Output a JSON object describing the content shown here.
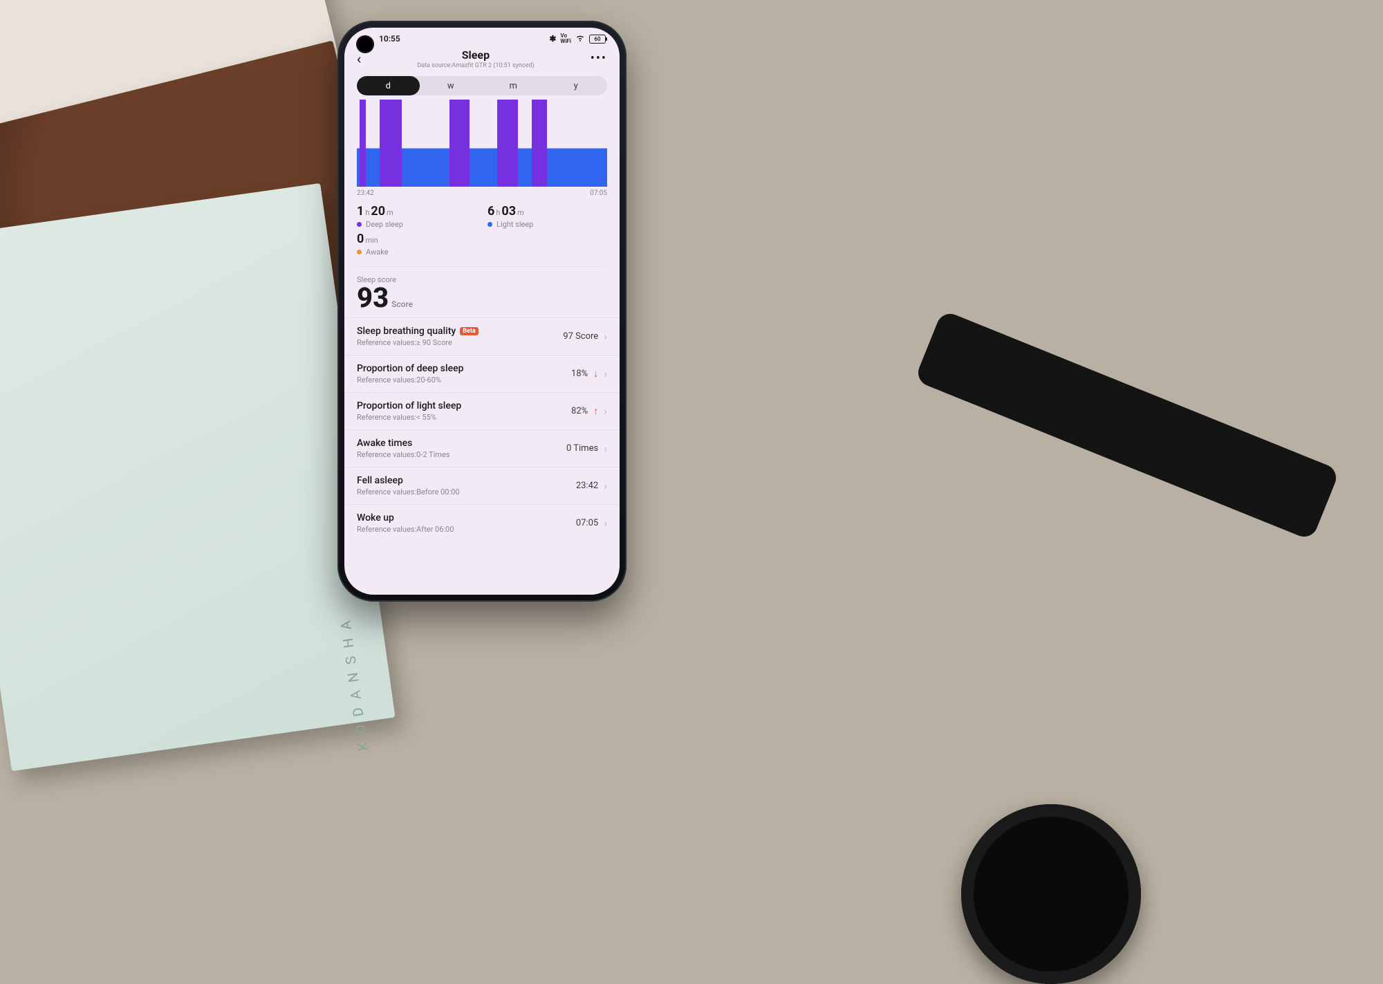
{
  "status": {
    "time": "10:55",
    "battery_text": "60"
  },
  "header": {
    "title": "Sleep",
    "subtitle": "Data source:Amazfit GTR 2 (10:51 synced)"
  },
  "range": {
    "options": [
      "d",
      "w",
      "m",
      "y"
    ],
    "active": "d"
  },
  "chart_data": {
    "type": "bar",
    "title": "Sleep stages timeline",
    "xlabel": "",
    "ylabel": "",
    "x_start": "23:42",
    "x_end": "07:05",
    "light_sleep_band_pct_top": 56,
    "deep_segments_pct": [
      {
        "start": 1,
        "width": 2.5
      },
      {
        "start": 9,
        "width": 9
      },
      {
        "start": 37,
        "width": 8
      },
      {
        "start": 56,
        "width": 6
      },
      {
        "start": 62,
        "width": 2.5
      },
      {
        "start": 70,
        "width": 6
      }
    ],
    "legend": [
      {
        "key": "deep",
        "color": "#7630e0",
        "label": "Deep sleep",
        "value_primary": "1",
        "unit_primary": "h",
        "value_secondary": "20",
        "unit_secondary": "m"
      },
      {
        "key": "light",
        "color": "#3166f0",
        "label": "Light sleep",
        "value_primary": "6",
        "unit_primary": "h",
        "value_secondary": "03",
        "unit_secondary": "m"
      },
      {
        "key": "awake",
        "color": "#e29a2e",
        "label": "Awake",
        "value_primary": "0",
        "unit_primary": "min",
        "value_secondary": "",
        "unit_secondary": ""
      }
    ]
  },
  "score": {
    "caption": "Sleep score",
    "value": "93",
    "unit": "Score"
  },
  "rows": [
    {
      "title": "Sleep breathing quality",
      "badge": "Beta",
      "ref": "Reference values:≥ 90 Score",
      "value": "97 Score",
      "trend": ""
    },
    {
      "title": "Proportion of deep sleep",
      "badge": "",
      "ref": "Reference values:20-60%",
      "value": "18%",
      "trend": "down"
    },
    {
      "title": "Proportion of light sleep",
      "badge": "",
      "ref": "Reference values:< 55%",
      "value": "82%",
      "trend": "up"
    },
    {
      "title": "Awake times",
      "badge": "",
      "ref": "Reference values:0-2 Times",
      "value": "0 Times",
      "trend": ""
    },
    {
      "title": "Fell asleep",
      "badge": "",
      "ref": "Reference values:Before 00:00",
      "value": "23:42",
      "trend": ""
    },
    {
      "title": "Woke up",
      "badge": "",
      "ref": "Reference values:After 06:00",
      "value": "07:05",
      "trend": ""
    }
  ]
}
